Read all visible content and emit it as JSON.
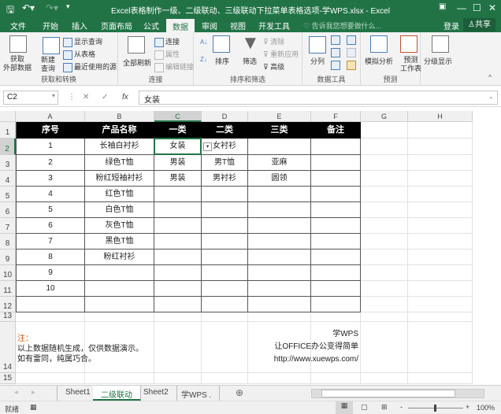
{
  "titlebar": {
    "title": "Excel表格制作一级、二级联动、三级联动下拉菜单表格选项-学WPS.xlsx - Excel",
    "save_icon": "save-icon",
    "undo_icon": "undo-icon",
    "redo_icon": "redo-icon"
  },
  "menu": {
    "tabs": [
      "文件",
      "开始",
      "插入",
      "页面布局",
      "公式",
      "数据",
      "审阅",
      "视图",
      "开发工具"
    ],
    "active": "数据",
    "tellme": "告诉我您想要做什么...",
    "login": "登录",
    "share": "共享"
  },
  "ribbon": {
    "get_transform": {
      "label": "获取和转换",
      "get_external": "获取\n外部数据",
      "new_query": "新建\n查询",
      "show_queries": "显示查询",
      "from_table": "从表格",
      "recent_sources": "最近使用的源"
    },
    "connections": {
      "label": "连接",
      "refresh_all": "全部刷新",
      "connections": "连接",
      "properties": "属性",
      "edit_links": "编辑链接"
    },
    "sort_filter": {
      "label": "排序和筛选",
      "sort": "排序",
      "filter": "筛选",
      "clear": "清除",
      "reapply": "重新应用",
      "advanced": "高级"
    },
    "data_tools": {
      "label": "数据工具",
      "text_to_columns": "分列"
    },
    "forecast": {
      "label": "预测",
      "what_if": "模拟分析",
      "forecast_sheet": "预测\n工作表"
    },
    "outline": {
      "label": "分级显示",
      "outline": "分级显示"
    }
  },
  "formula_bar": {
    "name_box": "C2",
    "value": "女装"
  },
  "columns": [
    "A",
    "B",
    "C",
    "D",
    "E",
    "F",
    "G",
    "H"
  ],
  "selected_column": "C",
  "rows": [
    "1",
    "2",
    "3",
    "4",
    "5",
    "6",
    "7",
    "8",
    "9",
    "10",
    "11",
    "12",
    "13",
    "14",
    "15"
  ],
  "selected_row": "2",
  "table": {
    "headers": [
      "序号",
      "产品名称",
      "一类",
      "二类",
      "三类",
      "备注"
    ],
    "body": [
      [
        "1",
        "长袖白衬衫",
        "女装",
        "女衬衫",
        "",
        ""
      ],
      [
        "2",
        "绿色T恤",
        "男装",
        "男T恤",
        "亚麻",
        ""
      ],
      [
        "3",
        "粉红短袖衬衫",
        "男装",
        "男衬衫",
        "圆领",
        ""
      ],
      [
        "4",
        "红色T恤",
        "",
        "",
        "",
        ""
      ],
      [
        "5",
        "白色T恤",
        "",
        "",
        "",
        ""
      ],
      [
        "6",
        "灰色T恤",
        "",
        "",
        "",
        ""
      ],
      [
        "7",
        "黑色T恤",
        "",
        "",
        "",
        ""
      ],
      [
        "8",
        "粉红衬衫",
        "",
        "",
        "",
        ""
      ],
      [
        "9",
        "",
        "",
        "",
        "",
        ""
      ],
      [
        "10",
        "",
        "",
        "",
        "",
        ""
      ],
      [
        "",
        "",
        "",
        "",
        "",
        ""
      ]
    ]
  },
  "notes": {
    "title": "注：",
    "line1": "以上数据随机生成，仅供数据演示。",
    "line2": "如有雷同，纯属巧合。",
    "brand1": "学WPS",
    "brand2": "让OFFICE办公变得简单",
    "url": "http://www.xuewps.com/"
  },
  "colors": {
    "accent": "#217346",
    "note_title": "#c55a11"
  },
  "sheet_tabs": [
    "Sheet1",
    "二级联动",
    "Sheet2",
    "学WPS ."
  ],
  "active_sheet": "二级联动",
  "status": {
    "ready": "就绪",
    "zoom": "100%"
  }
}
